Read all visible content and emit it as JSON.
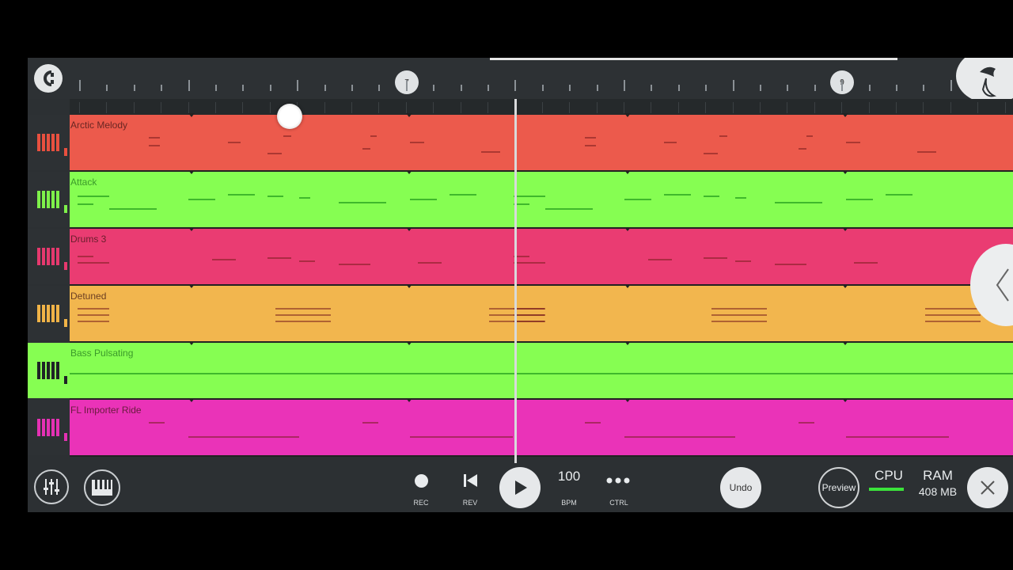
{
  "ruler": {
    "markers": [
      "7",
      "9"
    ]
  },
  "tracks": [
    {
      "name": "Arctic Melody",
      "color": "#ec5a4c",
      "icon_color": "#e8503f"
    },
    {
      "name": "Attack",
      "color": "#86fe52",
      "icon_color": "#7ef04a"
    },
    {
      "name": "Drums 3",
      "color": "#ea3c72",
      "icon_color": "#e6396e"
    },
    {
      "name": "Detuned",
      "color": "#f2b64e",
      "icon_color": "#f0b347"
    },
    {
      "name": "Bass Pulsating",
      "color": "#86fe52",
      "icon_color": "#1f2326"
    },
    {
      "name": "FL Importer Ride",
      "color": "#ea33b8",
      "icon_color": "#e431b3"
    }
  ],
  "transport": {
    "rec_label": "REC",
    "rev_label": "REV",
    "tempo": "100",
    "tempo_label": "BPM",
    "ctrl_label": "CTRL",
    "undo_label": "Undo",
    "preview_label": "Preview",
    "cpu_label": "CPU",
    "ram_label": "RAM",
    "ram_value": "408 MB"
  },
  "icons": {
    "magnet": "magnet-icon",
    "logo": "fl-fruit-logo",
    "mixer": "mixer-icon",
    "piano": "piano-icon",
    "play": "play-icon",
    "close": "close-icon",
    "back": "chevron-left-icon"
  },
  "colors": {
    "cpu_meter": "#3be33b",
    "background": "#2c3033"
  }
}
